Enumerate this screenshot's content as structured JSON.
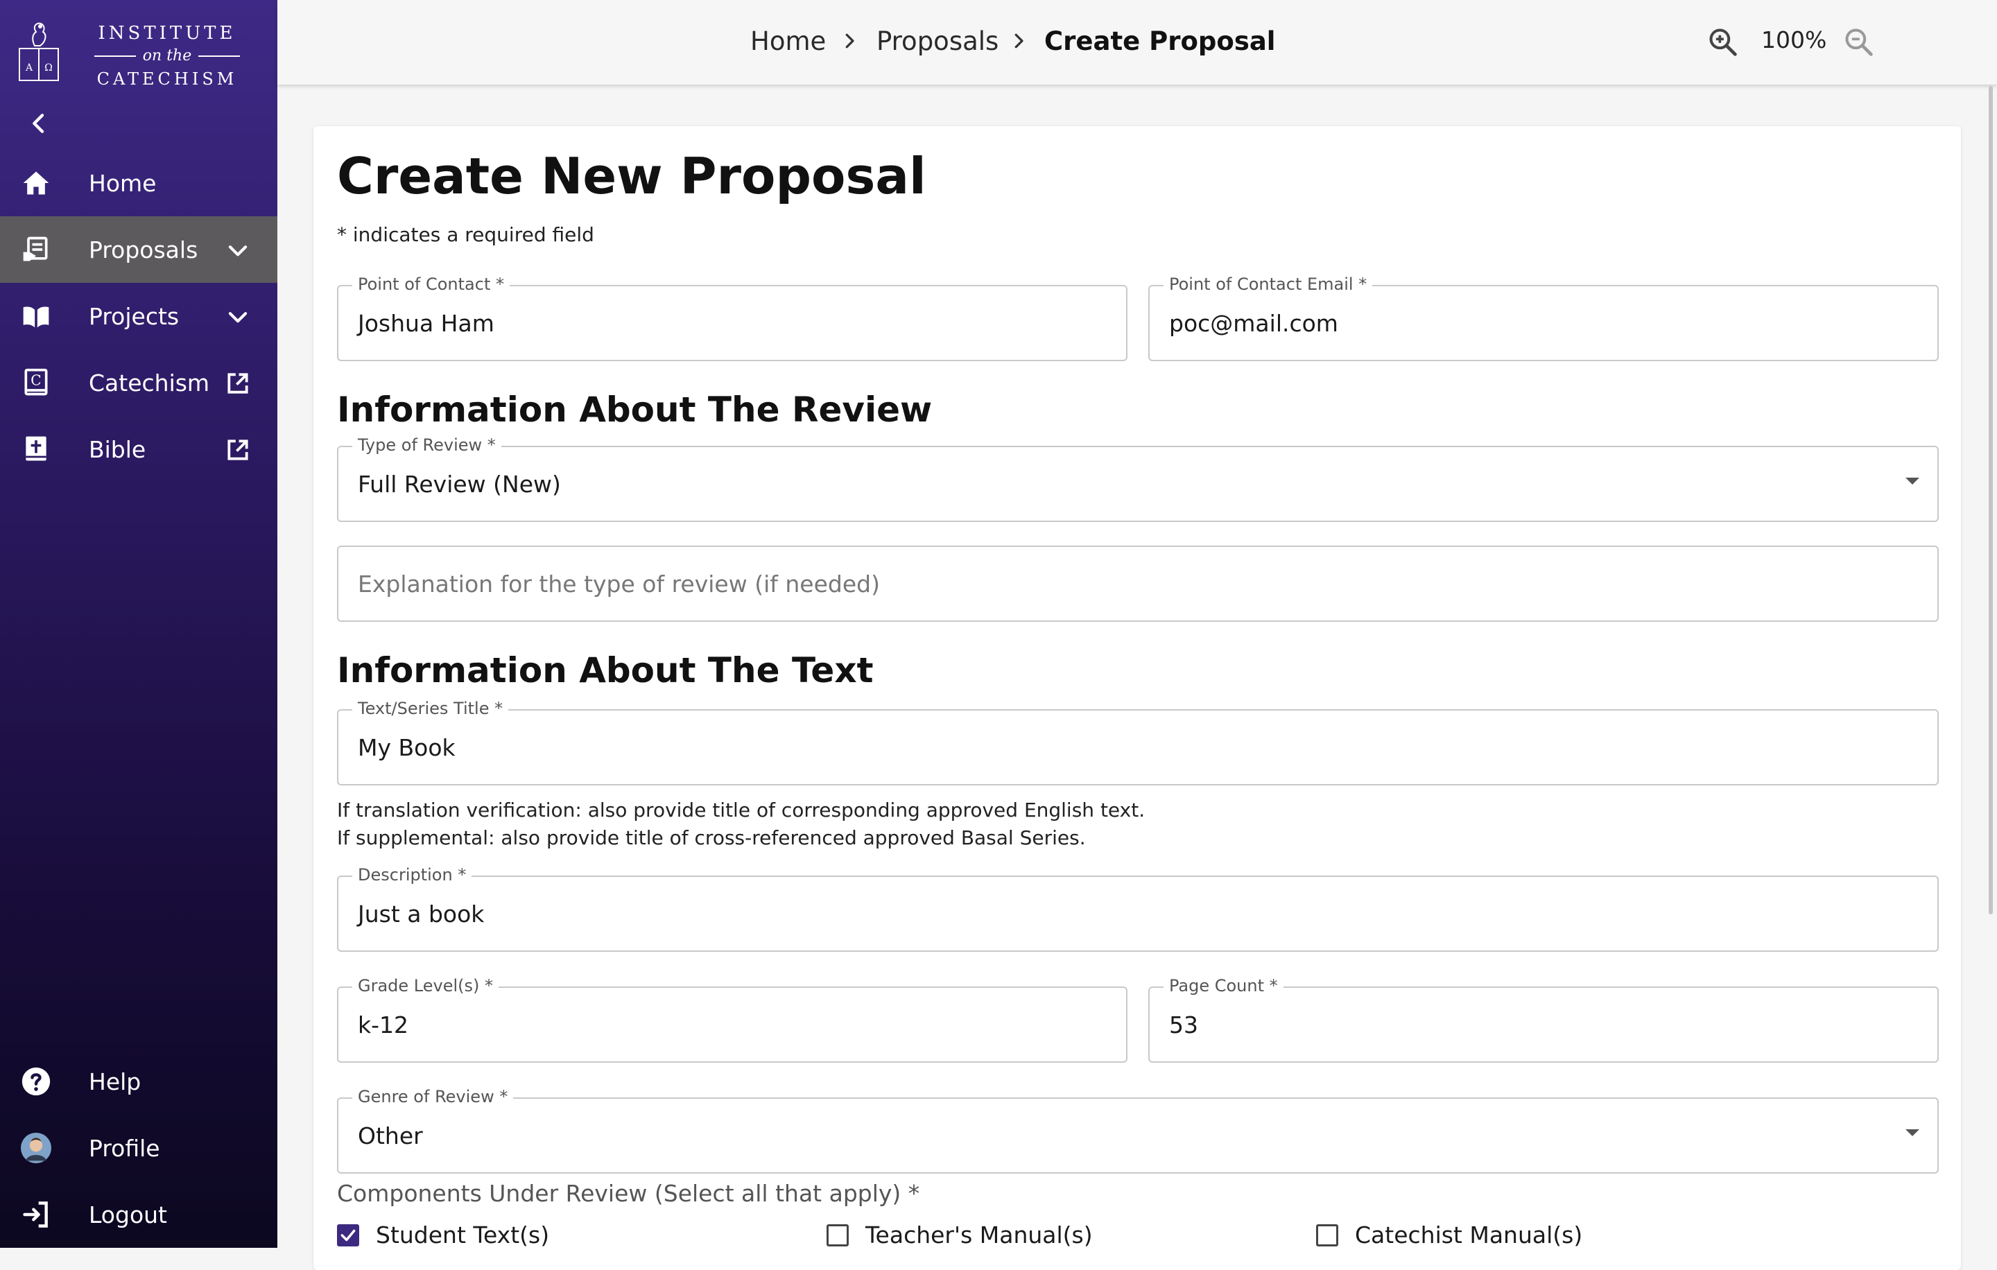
{
  "sidebar": {
    "logo": {
      "line1": "INSTITUTE",
      "line2": "on the",
      "line3": "CATECHISM"
    },
    "items": [
      {
        "label": "Home"
      },
      {
        "label": "Proposals"
      },
      {
        "label": "Projects"
      },
      {
        "label": "Catechism"
      },
      {
        "label": "Bible"
      }
    ],
    "bottom": [
      {
        "label": "Help"
      },
      {
        "label": "Profile"
      },
      {
        "label": "Logout"
      }
    ]
  },
  "topbar": {
    "breadcrumbs": [
      "Home",
      "Proposals",
      "Create Proposal"
    ],
    "zoom": "100%"
  },
  "form": {
    "title": "Create New Proposal",
    "required_note": "* indicates a required field",
    "point_of_contact": {
      "label": "Point of Contact *",
      "value": "Joshua Ham"
    },
    "poc_email": {
      "label": "Point of Contact Email *",
      "value": "poc@mail.com"
    },
    "review_section": "Information About The Review",
    "type_of_review": {
      "label": "Type of Review *",
      "value": "Full Review (New)"
    },
    "review_explanation": {
      "placeholder": "Explanation for the type of review (if needed)"
    },
    "text_section": "Information About The Text",
    "text_title": {
      "label": "Text/Series Title *",
      "value": "My Book"
    },
    "help_line1": "If translation verification: also provide title of corresponding approved English text.",
    "help_line2": "If supplemental: also provide title of cross-referenced approved Basal Series.",
    "description": {
      "label": "Description *",
      "value": "Just a book"
    },
    "grade_levels": {
      "label": "Grade Level(s) *",
      "value": "k-12"
    },
    "page_count": {
      "label": "Page Count *",
      "value": "53"
    },
    "genre": {
      "label": "Genre of Review *",
      "value": "Other"
    },
    "components_label": "Components Under Review (Select all that apply) *",
    "components": [
      {
        "label": "Student Text(s)",
        "checked": true
      },
      {
        "label": "Teacher's Manual(s)",
        "checked": false
      },
      {
        "label": "Catechist Manual(s)",
        "checked": false
      }
    ]
  },
  "colors": {
    "sidebar_top": "#3e2a86",
    "sidebar_bottom": "#0c0820",
    "active_item": "#5d5a5e",
    "checkbox": "#3c2a80"
  }
}
